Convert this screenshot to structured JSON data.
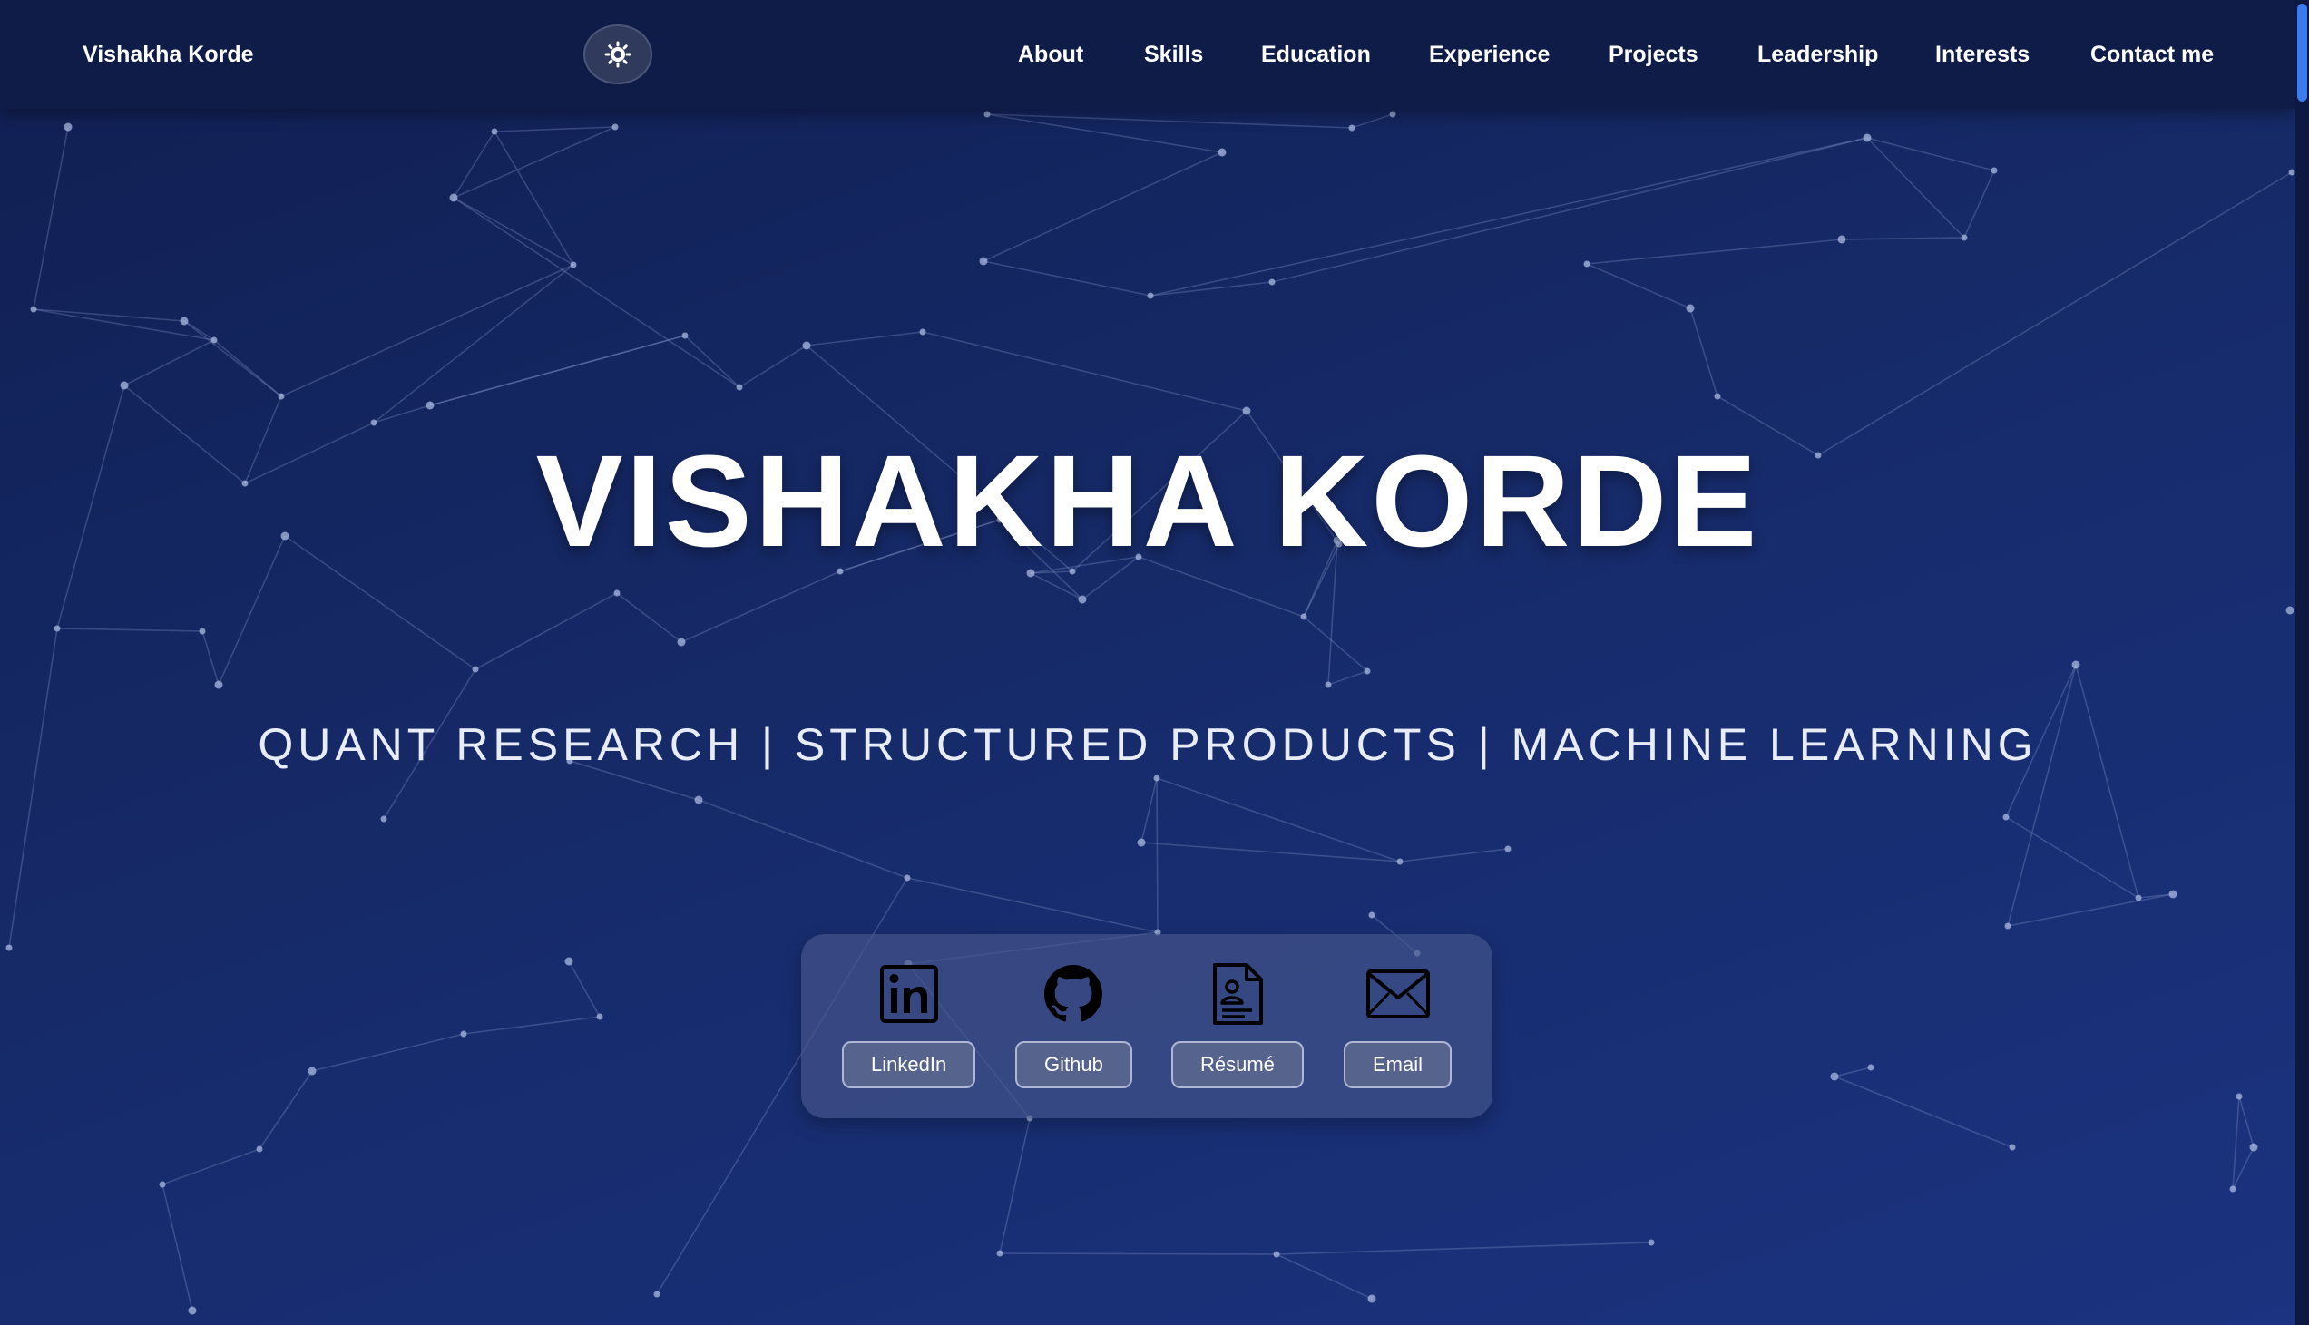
{
  "navbar": {
    "brand": "Vishakha Korde",
    "links": [
      "About",
      "Skills",
      "Education",
      "Experience",
      "Projects",
      "Leadership",
      "Interests",
      "Contact me"
    ]
  },
  "hero": {
    "name": "VISHAKHA KORDE",
    "tagline": "QUANT RESEARCH | STRUCTURED PRODUCTS | MACHINE LEARNING"
  },
  "social": {
    "linkedin": "LinkedIn",
    "github": "Github",
    "resume": "Résumé",
    "email": "Email"
  },
  "colors": {
    "background_top": "#101f52",
    "background_bottom": "#1b3380",
    "navbar": "#0f1c47",
    "scroll_thumb": "#3a7bf0"
  }
}
